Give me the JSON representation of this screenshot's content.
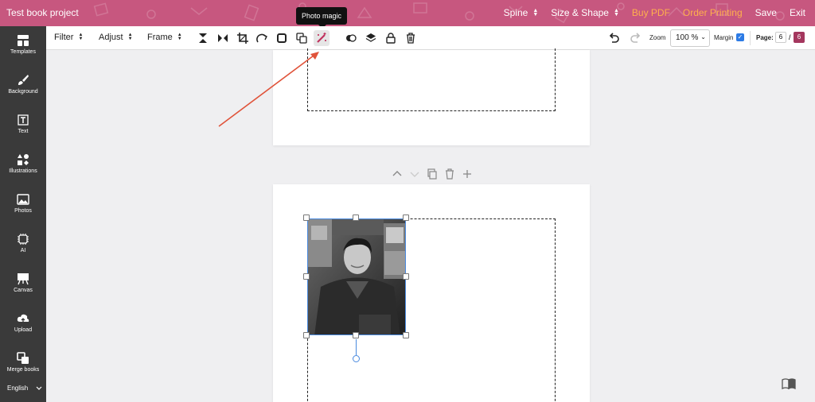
{
  "app": {
    "project_title": "Test book project"
  },
  "topmenu": {
    "spine": "Spine",
    "size_shape": "Size & Shape",
    "buy_pdf": "Buy PDF",
    "order_printing": "Order Printing",
    "save": "Save",
    "exit": "Exit"
  },
  "sidebar": {
    "items": [
      {
        "label": "Templates",
        "icon": "templates-icon"
      },
      {
        "label": "Background",
        "icon": "brush-icon"
      },
      {
        "label": "Text",
        "icon": "text-icon"
      },
      {
        "label": "Illustrations",
        "icon": "shapes-icon"
      },
      {
        "label": "Photos",
        "icon": "image-icon"
      },
      {
        "label": "AI",
        "icon": "ai-chip-icon"
      },
      {
        "label": "Canvas",
        "icon": "easel-icon"
      },
      {
        "label": "Upload",
        "icon": "cloud-upload-icon"
      },
      {
        "label": "Merge books",
        "icon": "merge-icon"
      }
    ],
    "language": "English"
  },
  "toolbar": {
    "filter": "Filter",
    "adjust": "Adjust",
    "frame": "Frame",
    "zoom_label": "Zoom",
    "zoom_value": "100 %",
    "margin_label": "Margin",
    "margin_checked": true,
    "page_label": "Page:",
    "page_current": "6",
    "page_separator": "/",
    "page_total": "6"
  },
  "tooltip": {
    "text": "Photo magic"
  },
  "colors": {
    "topbar": "#c7577f",
    "sidebar": "#3a3a3a",
    "accent_orange": "#ffb04c",
    "page_badge": "#a4375e",
    "selection": "#4a8adf",
    "annotation_arrow": "#e0533a"
  }
}
